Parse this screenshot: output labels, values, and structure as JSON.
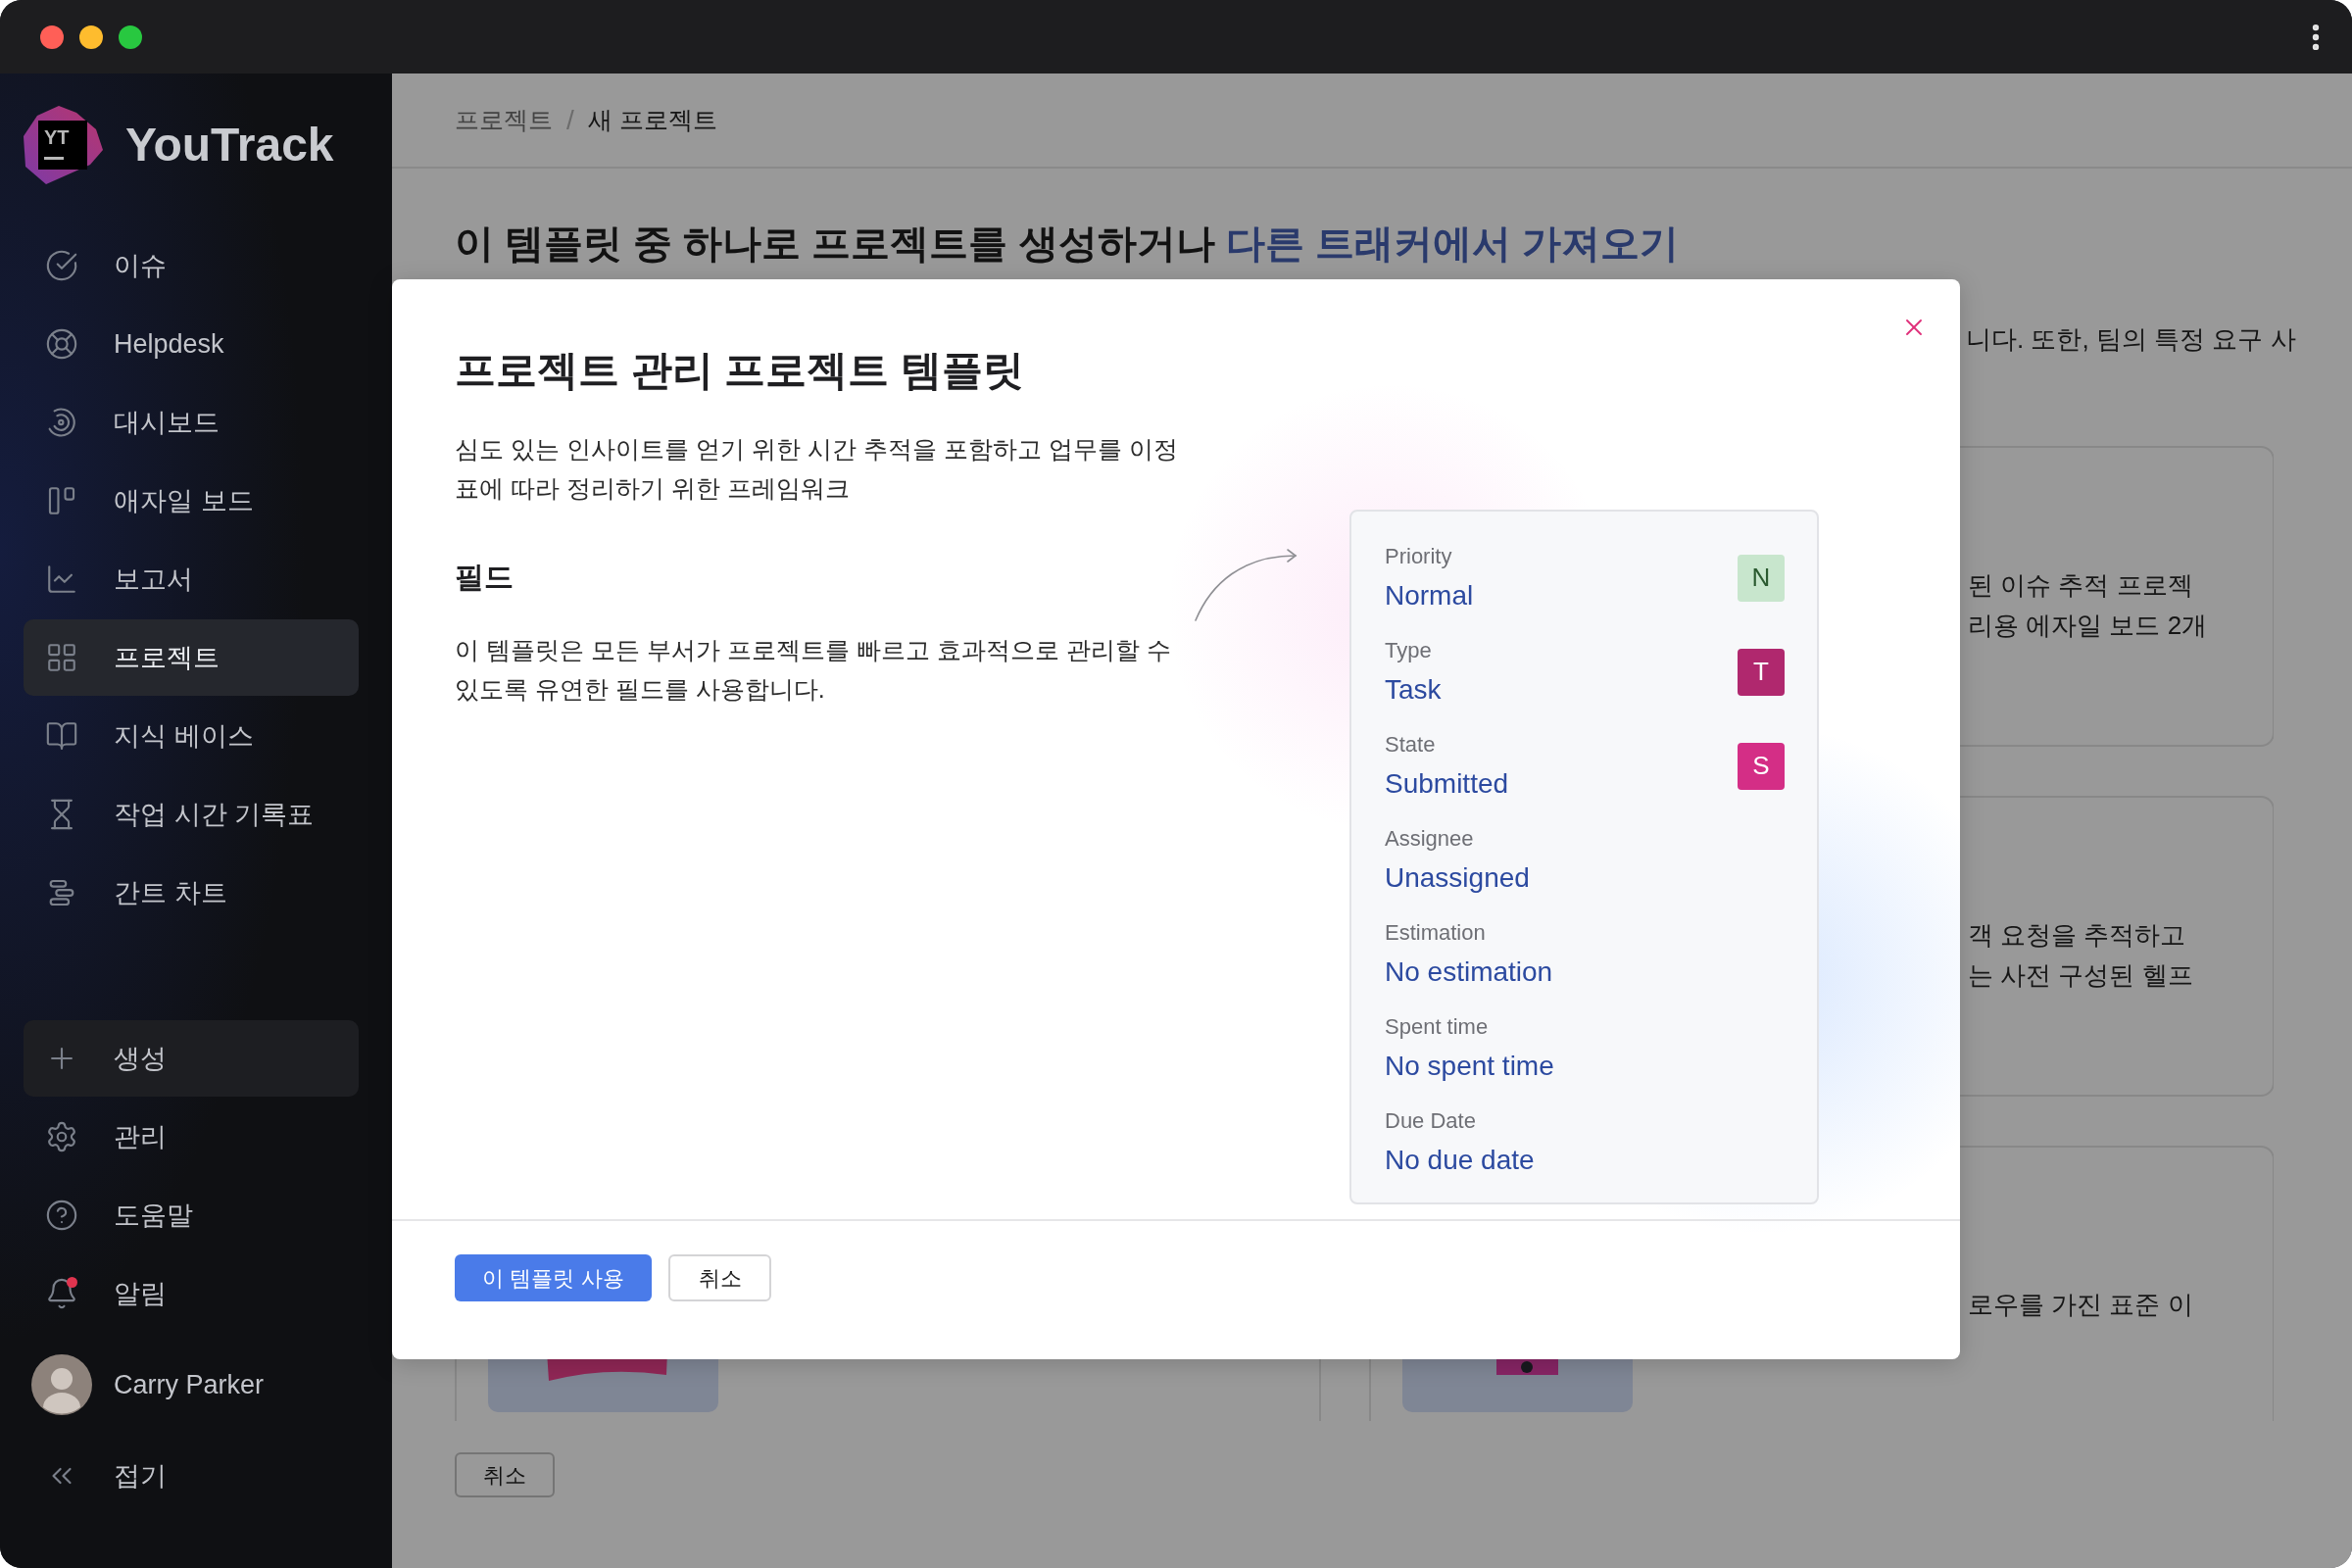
{
  "sidebar": {
    "logo": {
      "mark": "YT",
      "name": "YouTrack"
    },
    "nav_items": [
      {
        "label": "이슈",
        "selected": false
      },
      {
        "label": "Helpdesk",
        "selected": false
      },
      {
        "label": "대시보드",
        "selected": false
      },
      {
        "label": "애자일 보드",
        "selected": false
      },
      {
        "label": "보고서",
        "selected": false
      },
      {
        "label": "프로젝트",
        "selected": true
      },
      {
        "label": "지식 베이스",
        "selected": false
      },
      {
        "label": "작업 시간 기록표",
        "selected": false
      },
      {
        "label": "간트 차트",
        "selected": false
      }
    ],
    "create_button": {
      "label": "생성"
    },
    "bottom_items": [
      {
        "label": "관리",
        "unread": false
      },
      {
        "label": "도움말",
        "unread": false
      },
      {
        "label": "알림",
        "unread": true
      }
    ],
    "user": {
      "name": "Carry Parker"
    },
    "collapse": {
      "label": "접기"
    }
  },
  "page": {
    "breadcrumb": [
      {
        "label": "프로젝트",
        "current": false
      },
      {
        "label": "새 프로젝트",
        "current": true
      }
    ],
    "breadcrumb_separator": "/",
    "title": {
      "text": "이 템플릿 중 하나로 프로젝트를 생성하거나",
      "link": "다른 트래커에서 가져오기"
    },
    "intro_fragment": "니다. 또한, 팀의 특정 요구 사",
    "template_cards": [
      {
        "description_lines": [
          "된 이슈 추적 프로젝",
          "리용 에자일 보드 2개"
        ]
      },
      {
        "description_lines": [
          "객 요청을 추적하고",
          "는 사전 구성된 헬프"
        ]
      },
      {
        "description_lines": [
          "로우를 가진 표준 이"
        ]
      }
    ],
    "cancel_button": {
      "label": "취소"
    }
  },
  "dialog": {
    "title": "프로젝트 관리 프로젝트 템플릿",
    "description": "심도 있는 인사이트를 얻기 위한 시간 추적을 포함하고 업무를 이정표에 따라 정리하기 위한 프레임워크",
    "fields_heading": "필드",
    "fields_description": "이 템플릿은 모든 부서가 프로젝트를 빠르고 효과적으로 관리할 수 있도록 유연한 필드를 사용합니다.",
    "fields": [
      {
        "name": "Priority",
        "value": "Normal",
        "badge": "N",
        "color": "#c8e6cd"
      },
      {
        "name": "Type",
        "value": "Task",
        "badge": "T",
        "color": "#b0286e"
      },
      {
        "name": "State",
        "value": "Submitted",
        "badge": "S",
        "color": "#d42e86"
      },
      {
        "name": "Assignee",
        "value": "Unassigned"
      },
      {
        "name": "Estimation",
        "value": "No estimation"
      },
      {
        "name": "Spent time",
        "value": "No spent time"
      },
      {
        "name": "Due Date",
        "value": "No due date"
      }
    ],
    "buttons": [
      {
        "label": "이 템플릿 사용",
        "kind": "primary"
      },
      {
        "label": "취소",
        "kind": "secondary"
      }
    ]
  }
}
